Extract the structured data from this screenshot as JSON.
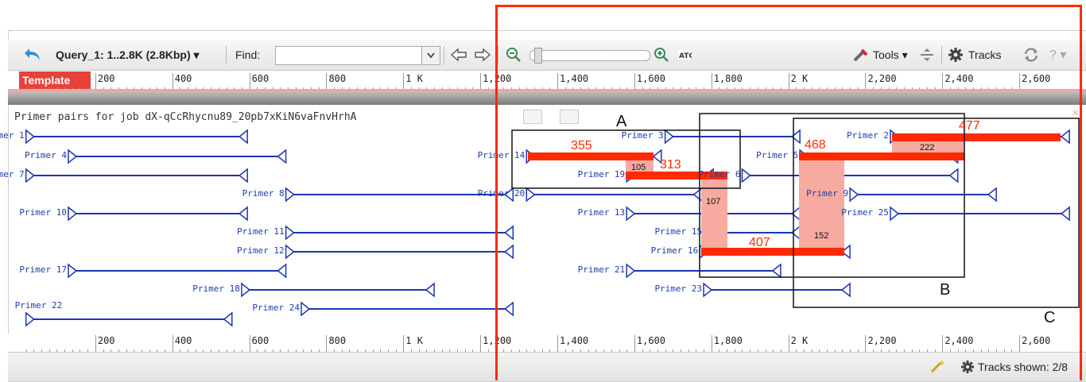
{
  "toolbar": {
    "query_label": "Query_1: 1..2.8K (2.8Kbp) ▾",
    "find_label": "Find:",
    "find_value": "",
    "tools_label": "Tools ▾",
    "tracks_label": "Tracks",
    "help_label": "? ▾"
  },
  "ruler": {
    "name": "Template",
    "top_labels": [
      "200",
      "400",
      "600",
      "800",
      "1 K",
      "1,200",
      "1,400",
      "1,600",
      "1,800",
      "2 K",
      "2,200",
      "2,400",
      "2,600"
    ],
    "bottom_labels": [
      "200",
      "400",
      "600",
      "800",
      "1 K",
      "1,200",
      "1,400",
      "1,600",
      "1,800",
      "2 K",
      "2,200",
      "2,400",
      "2,600"
    ]
  },
  "track": {
    "title": "Primer pairs for job dX-qCcRhycnu89_20pb7xKiN6vaFnvHrhA"
  },
  "primers": [
    {
      "label": "Primer 1",
      "start": 20,
      "end": 595
    },
    {
      "label": "Primer 4",
      "start": 130,
      "end": 695
    },
    {
      "label": "Primer 7",
      "start": 20,
      "end": 595
    },
    {
      "label": "Primer 8",
      "start": 695,
      "end": 1285
    },
    {
      "label": "Primer 10",
      "start": 130,
      "end": 595
    },
    {
      "label": "Primer 11",
      "start": 695,
      "end": 1285
    },
    {
      "label": "Primer 12",
      "start": 695,
      "end": 1285
    },
    {
      "label": "Primer 17",
      "start": 130,
      "end": 695
    },
    {
      "label": "Primer 18",
      "start": 580,
      "end": 1080
    },
    {
      "label": "Primer 22",
      "start": 20,
      "end": 555
    },
    {
      "label": "Primer 24",
      "start": 735,
      "end": 1285
    },
    {
      "label": "Primer 3",
      "start": 1680,
      "end": 2030
    },
    {
      "label": "Primer 14",
      "start": 1320,
      "end": 1670
    },
    {
      "label": "Primer 19",
      "start": 1580,
      "end": 1805
    },
    {
      "label": "Primer 20",
      "start": 1320,
      "end": 1775
    },
    {
      "label": "Primer 13",
      "start": 1580,
      "end": 2030
    },
    {
      "label": "Primer 15",
      "start": 1780,
      "end": 2030
    },
    {
      "label": "Primer 16",
      "start": 1770,
      "end": 2160
    },
    {
      "label": "Primer 21",
      "start": 1580,
      "end": 1980
    },
    {
      "label": "Primer 23",
      "start": 1780,
      "end": 2160
    },
    {
      "label": "Primer 2",
      "start": 2265,
      "end": 2730
    },
    {
      "label": "Primer 5",
      "start": 2030,
      "end": 2440
    },
    {
      "label": "Primer 6",
      "start": 1880,
      "end": 2440
    },
    {
      "label": "Primer 9",
      "start": 2160,
      "end": 2540
    },
    {
      "label": "Primer 25",
      "start": 2265,
      "end": 2730
    }
  ],
  "annotations": {
    "bar_labels": [
      "477",
      "355",
      "468",
      "313",
      "407"
    ],
    "overlap_labels": [
      "222",
      "105",
      "107",
      "152"
    ],
    "box_labels": [
      "A",
      "B",
      "C"
    ]
  },
  "status": {
    "tracks_shown": "Tracks shown: 2/8"
  },
  "colors": {
    "primer_blue": "#1d35b5",
    "highlight_red": "#ff2a00",
    "overlap_pink": "#f6aaa0",
    "template_red": "#e8413a"
  }
}
